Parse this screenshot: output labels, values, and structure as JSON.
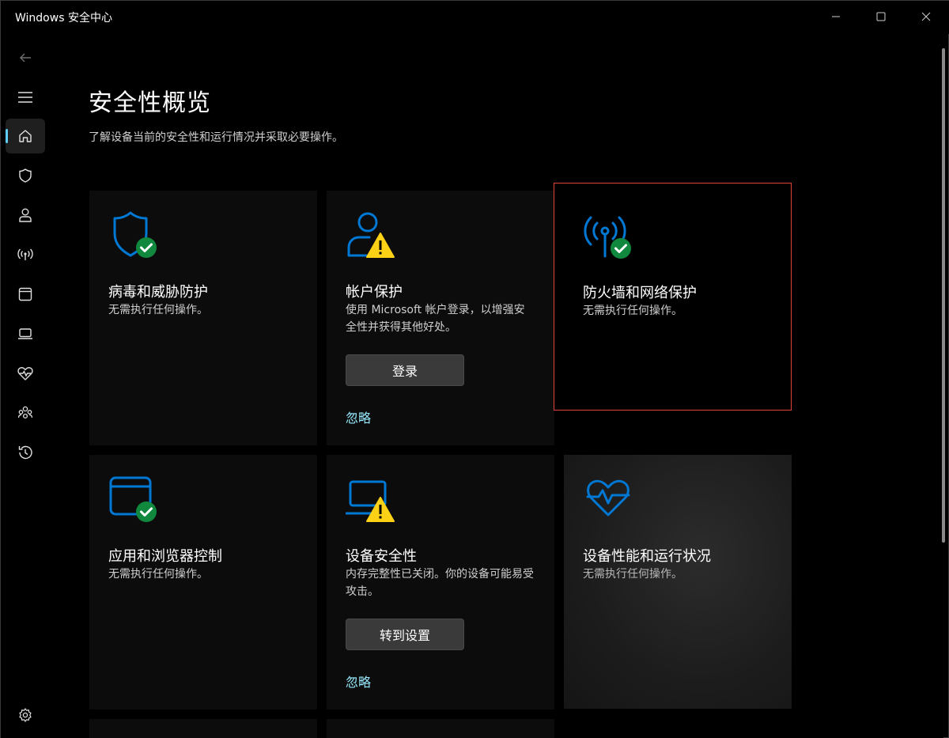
{
  "window": {
    "title": "Windows 安全中心"
  },
  "sidebar": {
    "items": [
      {
        "icon": "back-arrow-icon"
      },
      {
        "icon": "hamburger-menu-icon"
      },
      {
        "icon": "home-icon",
        "active": true
      },
      {
        "icon": "shield-icon"
      },
      {
        "icon": "account-icon"
      },
      {
        "icon": "wireless-icon"
      },
      {
        "icon": "browser-window-icon"
      },
      {
        "icon": "laptop-icon"
      },
      {
        "icon": "heart-pulse-icon"
      },
      {
        "icon": "family-icon"
      },
      {
        "icon": "history-icon"
      },
      {
        "icon": "settings-gear-icon"
      }
    ]
  },
  "page": {
    "title": "安全性概览",
    "subtitle": "了解设备当前的安全性和运行情况并采取必要操作。"
  },
  "cards": [
    {
      "id": "virus",
      "icon": "shield-check-icon",
      "status": "ok",
      "title": "病毒和威胁防护",
      "description": "无需执行任何操作。"
    },
    {
      "id": "account",
      "icon": "account-warning-icon",
      "status": "warning",
      "title": "帐户保护",
      "description": "使用 Microsoft 帐户登录，以增强安全性并获得其他好处。",
      "action": "登录",
      "dismiss": "忽略"
    },
    {
      "id": "firewall",
      "icon": "firewall-wireless-check-icon",
      "status": "ok",
      "title": "防火墙和网络保护",
      "description": "无需执行任何操作。"
    },
    {
      "id": "browser",
      "icon": "browser-check-icon",
      "status": "ok",
      "title": "应用和浏览器控制",
      "description": "无需执行任何操作。"
    },
    {
      "id": "device",
      "icon": "laptop-warning-icon",
      "status": "warning",
      "title": "设备安全性",
      "description": "内存完整性已关闭。你的设备可能易受攻击。",
      "action": "转到设置",
      "dismiss": "忽略"
    },
    {
      "id": "health",
      "icon": "heart-pulse-icon",
      "status": "ok",
      "title": "设备性能和运行状况",
      "description": "无需执行任何操作。"
    }
  ],
  "colors": {
    "accent_blue": "#0078d4",
    "ok_green": "#10893e",
    "warning_yellow": "#fcd116",
    "link": "#99ebff",
    "highlight_border": "#e0433b"
  }
}
